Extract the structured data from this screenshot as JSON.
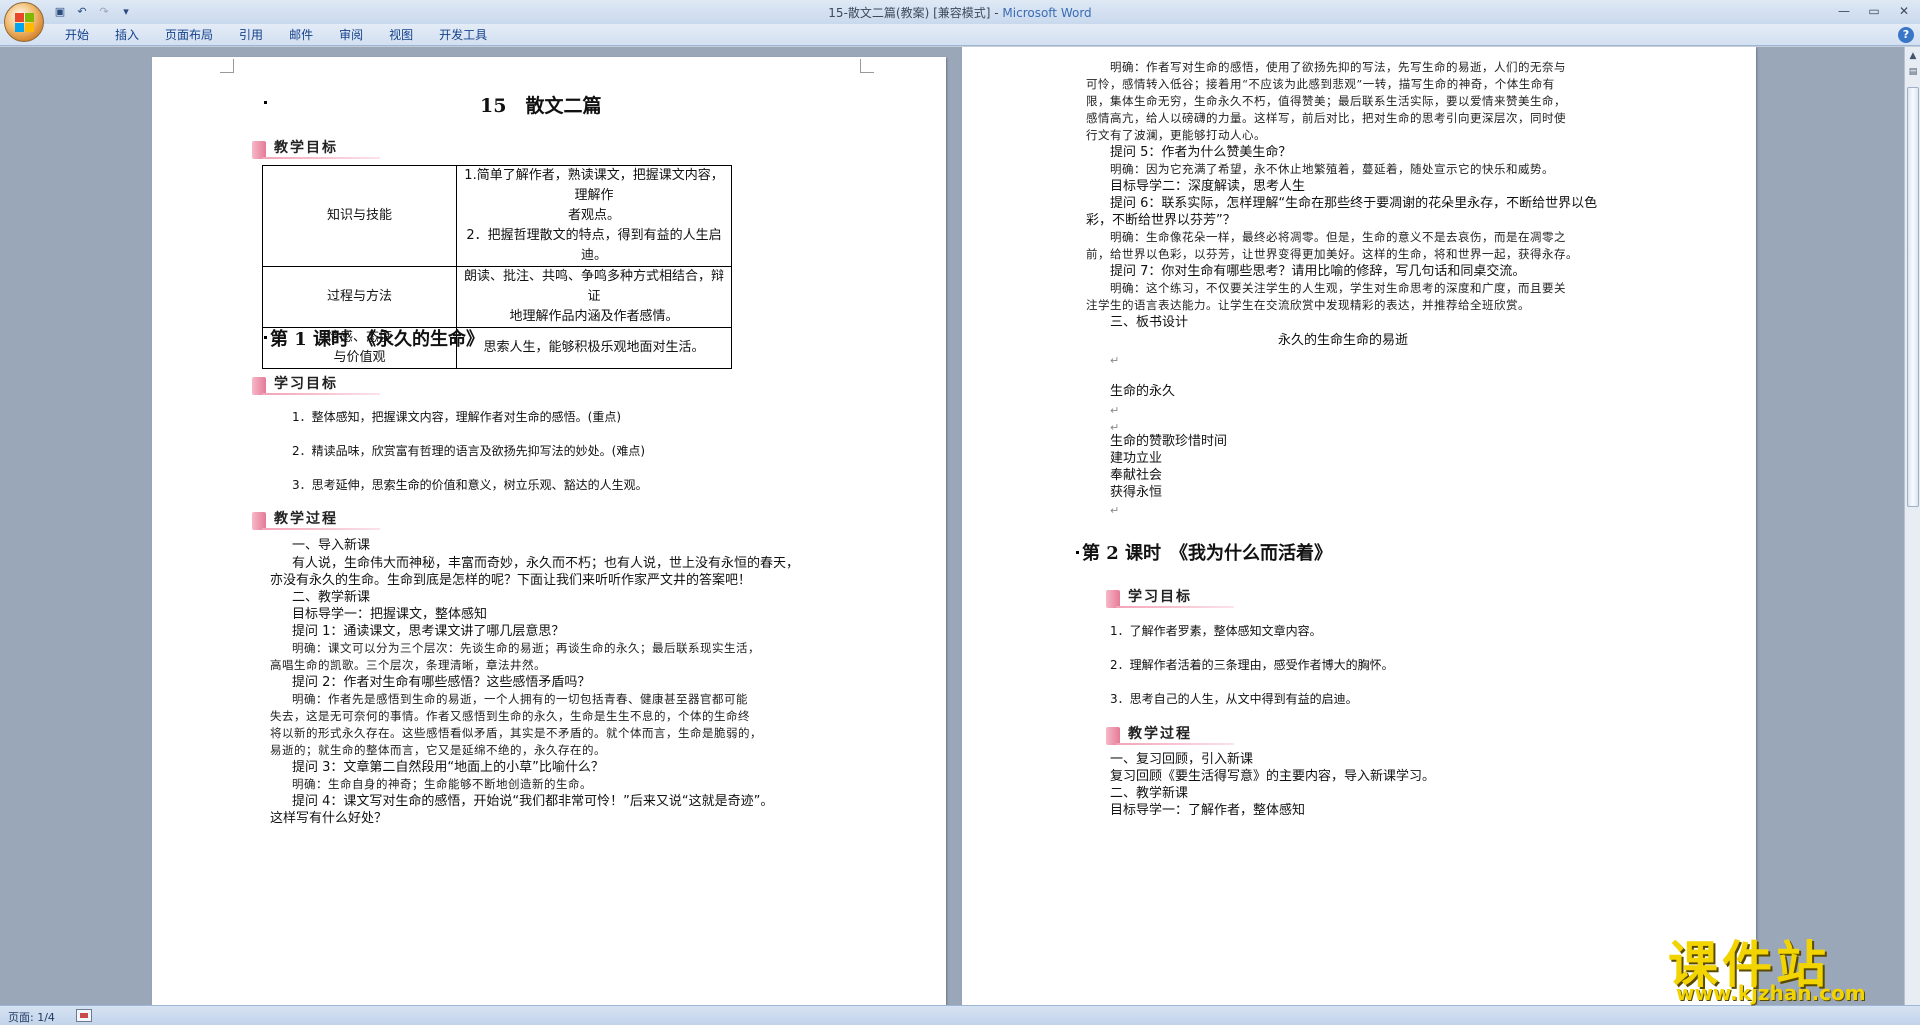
{
  "window": {
    "title_doc": "15-散文二篇(教案) [兼容模式] - ",
    "title_app": "Microsoft Word"
  },
  "ribbon": {
    "tabs": [
      "开始",
      "插入",
      "页面布局",
      "引用",
      "邮件",
      "审阅",
      "视图",
      "开发工具"
    ]
  },
  "statusbar": {
    "page": "页面: 1/4"
  },
  "watermark": {
    "big": "课件站",
    "url": "www.kjzhan.com"
  },
  "page1": {
    "title": "15　散文二篇",
    "teaching_goals_label": "教学目标",
    "table": [
      {
        "cat": "知识与技能",
        "content": [
          "1.简单了解作者，熟读课文，把握课文内容，理解作",
          "者观点。",
          "2．把握哲理散文的特点，得到有益的人生启迪。"
        ]
      },
      {
        "cat": "过程与方法",
        "content": [
          "朗读、批注、共鸣、争鸣多种方式相结合，辩证",
          "地理解作品内涵及作者感情。"
        ]
      },
      {
        "cat": [
          "情感、态度",
          "与价值观"
        ],
        "content": [
          "思索人生，能够积极乐观地面对生活。"
        ]
      }
    ],
    "lesson1_title": "第 1 课时　《永久的生命》",
    "learning_goals_label": "学习目标",
    "learning_goals": [
      "1．整体感知，把握课文内容，理解作者对生命的感悟。(重点)",
      "2．精读品味，欣赏富有哲理的语言及欲扬先抑写法的妙处。(难点)",
      "3．思考延伸，思索生命的价值和意义，树立乐观、豁达的人生观。"
    ],
    "process_label": "教学过程",
    "lines": [
      "一、导入新课",
      "有人说，生命伟大而神秘，丰富而奇妙，永久而不朽；也有人说，世上没有永恒的春天，",
      "亦没有永久的生命。生命到底是怎样的呢？下面让我们来听听作家严文井的答案吧！",
      "二、教学新课",
      "目标导学一：把握课文，整体感知",
      "提问 1：通读课文，思考课文讲了哪几层意思？",
      "明确：课文可以分为三个层次：先谈生命的易逝；再谈生命的永久；最后联系现实生活，",
      "高唱生命的凯歌。三个层次，条理清晰，章法井然。",
      "提问 2：作者对生命有哪些感悟？这些感悟矛盾吗？",
      "明确：作者先是感悟到生命的易逝，一个人拥有的一切包括青春、健康甚至器官都可能",
      "失去，这是无可奈何的事情。作者又感悟到生命的永久，生命是生生不息的，个体的生命终",
      "将以新的形式永久存在。这些感悟看似矛盾，其实是不矛盾的。就个体而言，生命是脆弱的，",
      "易逝的；就生命的整体而言，它又是延绵不绝的，永久存在的。",
      "提问 3：文章第二自然段用“地面上的小草”比喻什么？",
      "明确：生命自身的神奇；生命能够不断地创造新的生命。",
      "提问 4：课文写对生命的感悟，开始说“我们都非常可怜！”后来又说“这就是奇迹”。",
      "这样写有什么好处？"
    ]
  },
  "page2": {
    "lines": [
      "明确：作者写对生命的感悟，使用了欲扬先抑的写法，先写生命的易逝，人们的无奈与",
      "可怜，感情转入低谷；接着用“不应该为此感到悲观”一转，描写生命的神奇，个体生命有",
      "限，集体生命无穷，生命永久不朽，值得赞美；最后联系生活实际，要以爱情来赞美生命，",
      "感情高亢，给人以磅礴的力量。这样写，前后对比，把对生命的思考引向更深层次，同时使",
      "行文有了波澜，更能够打动人心。",
      "提问 5：作者为什么赞美生命？",
      "明确：因为它充满了希望，永不休止地繁殖着，蔓延着，随处宣示它的快乐和威势。",
      "目标导学二：深度解读，思考人生",
      "提问 6：联系实际，怎样理解“生命在那些终于要凋谢的花朵里永存，不断给世界以色",
      "彩，不断给世界以芬芳”？",
      "明确：生命像花朵一样，最终必将凋零。但是，生命的意义不是去哀伤，而是在凋零之",
      "前，给世界以色彩，以芬芳，让世界变得更加美好。这样的生命，将和世界一起，获得永存。",
      "提问 7：你对生命有哪些思考？请用比喻的修辞，写几句话和同桌交流。",
      "明确：这个练习，不仅要关注学生的人生观，学生对生命思考的深度和广度，而且要关",
      "注学生的语言表达能力。让学生在交流欣赏中发现精彩的表达，并推荐给全班欣赏。",
      "三、板书设计"
    ],
    "board_title": "永久的生命生命的易逝",
    "board_items": [
      "生命的永久",
      "生命的赞歌珍惜时间",
      "建功立业",
      "奉献社会",
      "获得永恒"
    ],
    "lesson2_title": "第 2 课时　《我为什么而活着》",
    "learning_goals_label": "学习目标",
    "learning_goals": [
      "1．了解作者罗素，整体感知文章内容。",
      "2．理解作者活着的三条理由，感受作者博大的胸怀。",
      "3．思考自己的人生，从文中得到有益的启迪。"
    ],
    "process_label": "教学过程",
    "process_lines": [
      "一、复习回顾，引入新课",
      "复习回顾《要生活得写意》的主要内容，导入新课学习。",
      "二、教学新课",
      "目标导学一：了解作者，整体感知"
    ]
  }
}
